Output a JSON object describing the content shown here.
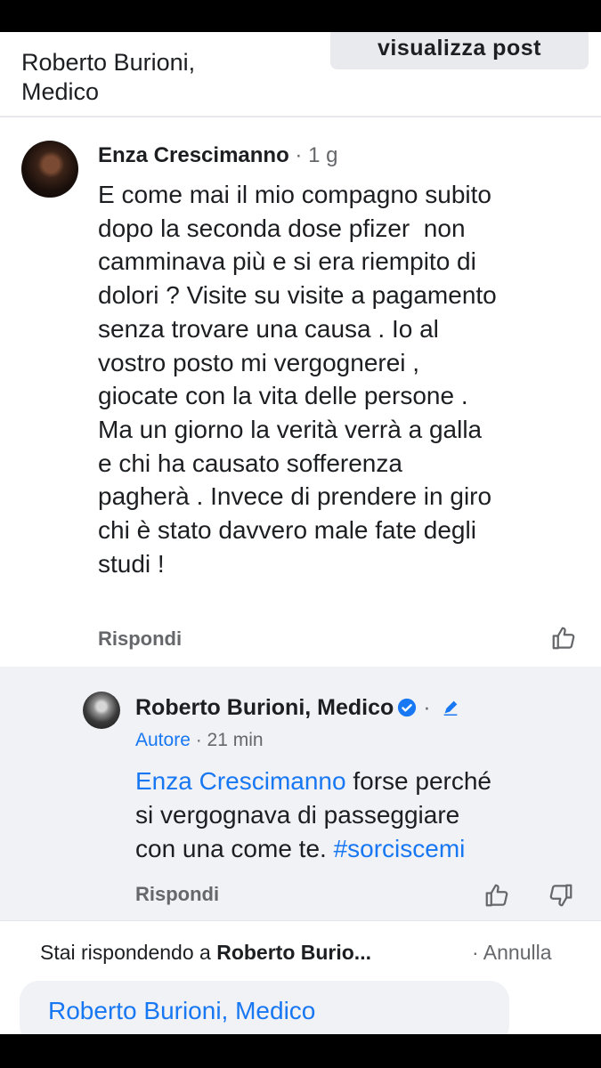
{
  "header": {
    "title_line1": "Roberto Burioni,",
    "title_line2": "Medico",
    "view_post_label": "visualizza post"
  },
  "comment": {
    "author": "Enza Crescimanno",
    "separator": " · ",
    "time": "1 g",
    "lines": [
      "E come mai il mio compagno subito",
      "dopo la seconda dose pfizer  non",
      "camminava più e si era riempito di",
      "dolori ? Visite su visite a pagamento",
      "senza trovare una causa . Io al",
      "vostro posto mi vergognerei ,",
      "giocate con la vita delle persone .",
      "Ma un giorno la verità verrà a galla",
      "e chi ha causato sofferenza",
      "pagherà . Invece di prendere in giro",
      "chi è stato davvero male fate degli",
      "studi !"
    ],
    "reply_label": "Rispondi",
    "like_icon": "thumbs-up-outline"
  },
  "reply": {
    "author": "Roberto Burioni, Medico",
    "verified_icon": "verified-check",
    "separator": " · ",
    "role": "Autore",
    "time": "· 21 min",
    "mention": "Enza Crescimanno",
    "line1_rest": " forse perché",
    "line2": "si vergognava di passeggiare",
    "line3_text": "con una come te. ",
    "hashtag": "#sorciscemi",
    "reply_label": "Rispondi",
    "like_icon": "thumbs-up-outline",
    "dislike_icon": "thumbs-down-outline",
    "accent_color": "#1877f2"
  },
  "replying_bar": {
    "prefix": "Stai rispondendo a ",
    "name": "Roberto Burio...",
    "cancel_label": "· Annulla"
  },
  "composer": {
    "value": "Roberto Burioni, Medico"
  }
}
